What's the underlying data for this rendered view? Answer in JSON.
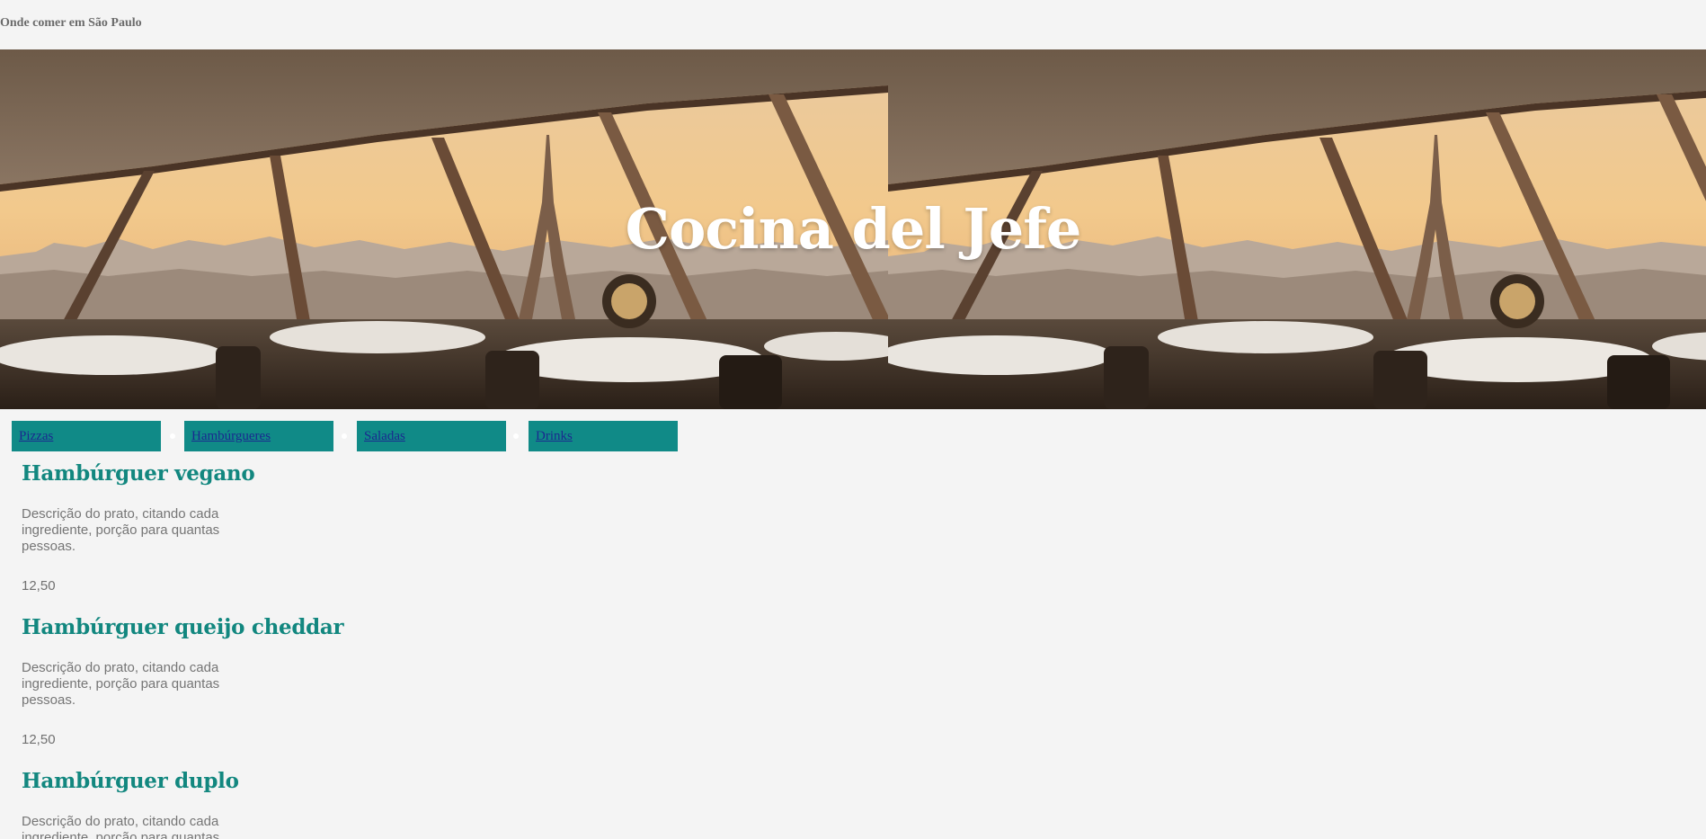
{
  "header": {
    "title": "Onde comer em São Paulo"
  },
  "hero": {
    "title": "Cocina del Jefe",
    "image": "restaurant-eiffel-tower-view"
  },
  "nav": {
    "items": [
      {
        "label": "Pizzas"
      },
      {
        "label": "Hambúrgueres"
      },
      {
        "label": "Saladas"
      },
      {
        "label": "Drinks"
      }
    ]
  },
  "menu": {
    "dishes": [
      {
        "name": "Hambúrguer vegano",
        "description": "Descrição do prato, citando cada ingrediente, porção para quantas pessoas.",
        "price": "12,50"
      },
      {
        "name": "Hambúrguer queijo cheddar",
        "description": "Descrição do prato, citando cada ingrediente, porção para quantas pessoas.",
        "price": "12,50"
      },
      {
        "name": "Hambúrguer duplo",
        "description": "Descrição do prato, citando cada ingrediente, porção para quantas pessoas.",
        "price": ""
      }
    ]
  },
  "colors": {
    "background": "#f4f4f4",
    "accent": "#108a87",
    "dish_title": "#12877f",
    "nav_link": "#1a2a8f"
  }
}
